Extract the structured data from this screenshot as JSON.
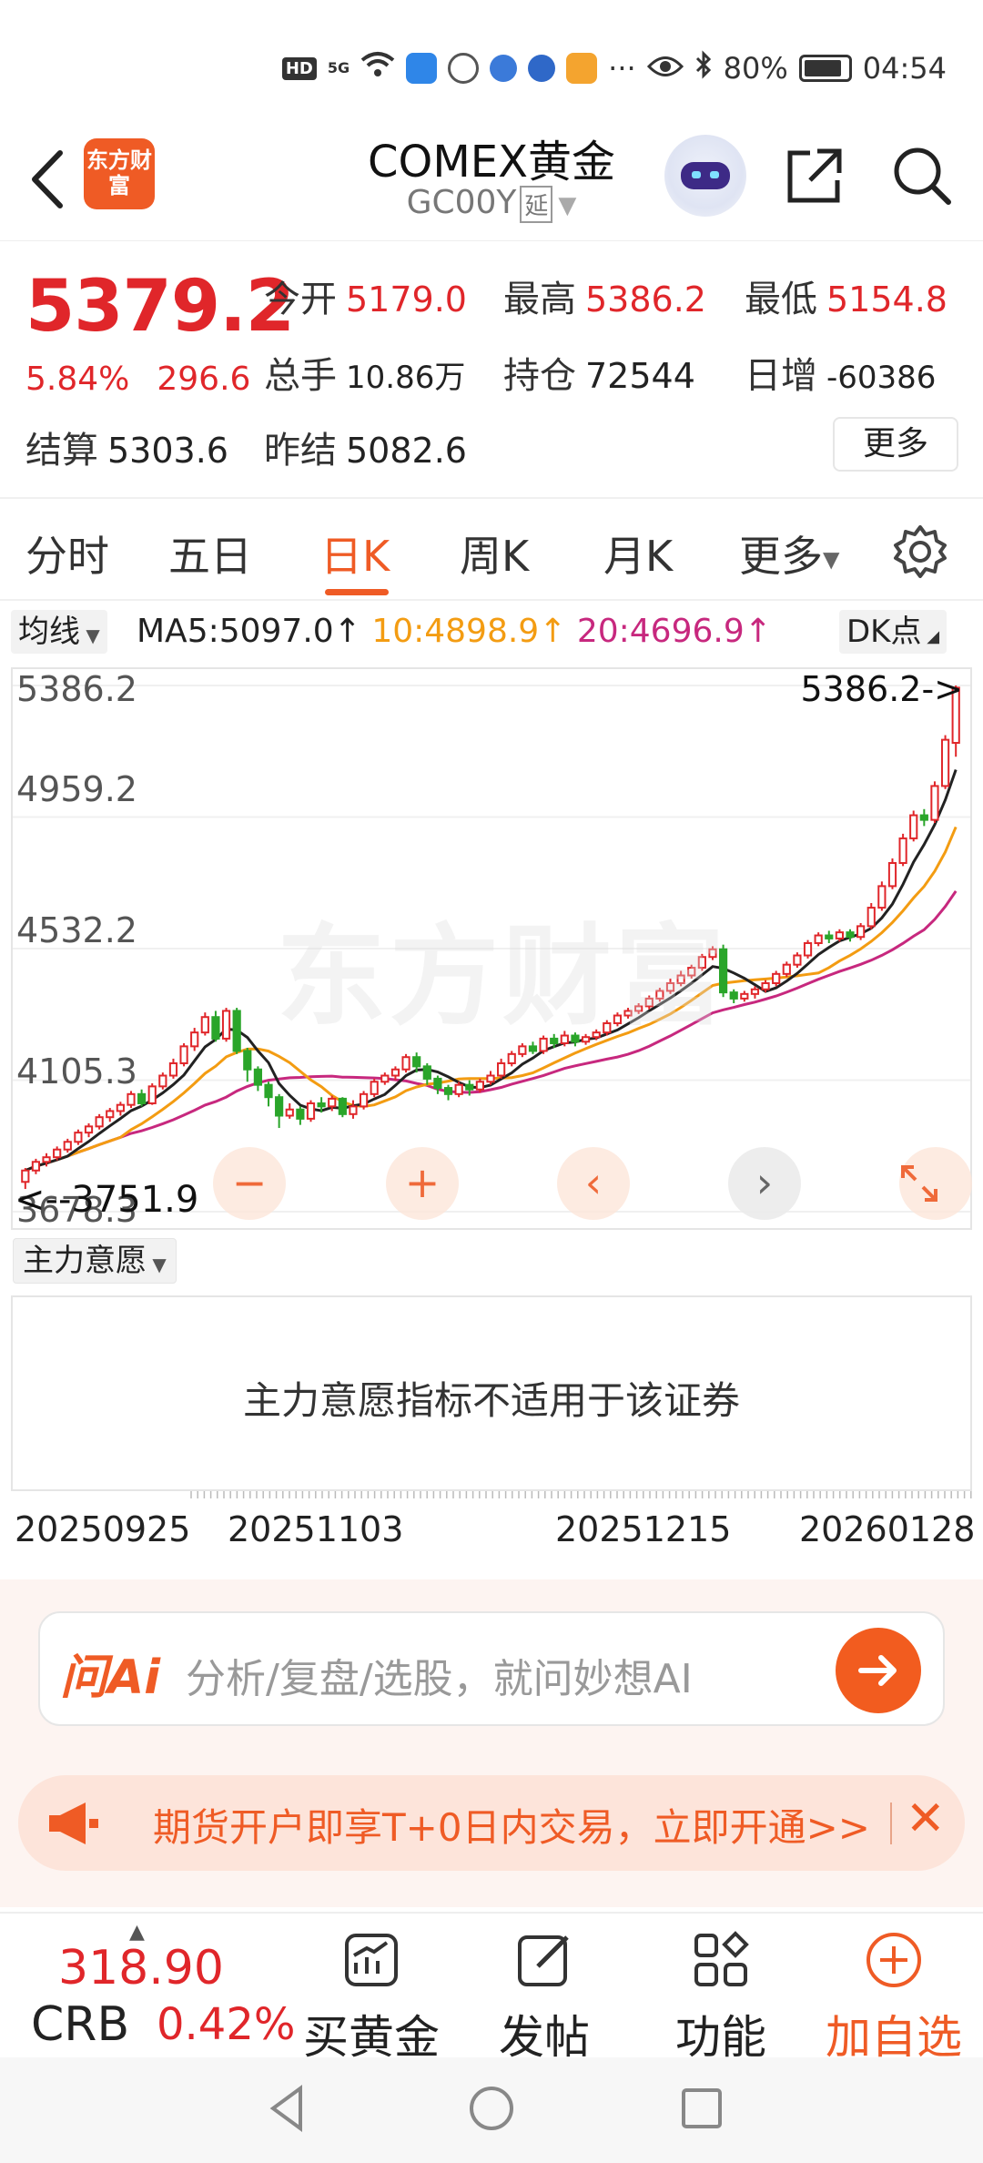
{
  "status": {
    "battery": "80%",
    "time": "04:54",
    "hd": "HD",
    "signal": "5G",
    "more": "···"
  },
  "header": {
    "logo": "东方财富",
    "title": "COMEX黄金",
    "code": "GC00Y",
    "delay_badge": "延"
  },
  "quote": {
    "price": "5379.2",
    "change_pct": "5.84%",
    "change": "296.6",
    "open_label": "今开",
    "open": "5179.0",
    "high_label": "最高",
    "high": "5386.2",
    "low_label": "最低",
    "low": "5154.8",
    "volume_label": "总手",
    "volume": "10.86万",
    "oi_label": "持仓",
    "oi": "72544",
    "daily_inc_label": "日增",
    "daily_inc": "-60386",
    "settle_label": "结算",
    "settle": "5303.6",
    "prev_settle_label": "昨结",
    "prev_settle": "5082.6",
    "more_button": "更多"
  },
  "tabs": [
    "分时",
    "五日",
    "日K",
    "周K",
    "月K",
    "更多"
  ],
  "active_tab": "日K",
  "ma": {
    "selector": "均线",
    "ma5": "MA5:5097.0↑",
    "ma10": "10:4898.9↑",
    "ma20": "20:4696.9↑",
    "dk": "DK点"
  },
  "chart_data": {
    "type": "candlestick",
    "y_ticks": [
      "5386.2",
      "4959.2",
      "4532.2",
      "4105.3",
      "3678.3"
    ],
    "high_marker": "5386.2->",
    "low_marker": "<--3751.9",
    "watermark": "东方财富",
    "ylim": [
      3678.3,
      5386.2
    ],
    "candles": [
      [
        3775,
        3812,
        3752,
        3820
      ],
      [
        3812,
        3840,
        3800,
        3850
      ],
      [
        3840,
        3855,
        3825,
        3868
      ],
      [
        3855,
        3880,
        3845,
        3890
      ],
      [
        3880,
        3905,
        3870,
        3915
      ],
      [
        3905,
        3935,
        3895,
        3945
      ],
      [
        3935,
        3955,
        3920,
        3965
      ],
      [
        3955,
        3985,
        3945,
        3995
      ],
      [
        3985,
        4005,
        3970,
        4015
      ],
      [
        4005,
        4025,
        3990,
        4035
      ],
      [
        4025,
        4060,
        4015,
        4070
      ],
      [
        4060,
        4030,
        4020,
        4075
      ],
      [
        4030,
        4085,
        4025,
        4095
      ],
      [
        4085,
        4120,
        4075,
        4130
      ],
      [
        4120,
        4160,
        4110,
        4175
      ],
      [
        4160,
        4215,
        4150,
        4225
      ],
      [
        4215,
        4260,
        4200,
        4275
      ],
      [
        4260,
        4310,
        4250,
        4325
      ],
      [
        4310,
        4240,
        4230,
        4330
      ],
      [
        4240,
        4330,
        4230,
        4340
      ],
      [
        4330,
        4200,
        4190,
        4340
      ],
      [
        4200,
        4140,
        4100,
        4210
      ],
      [
        4140,
        4090,
        4070,
        4150
      ],
      [
        4090,
        4050,
        4020,
        4100
      ],
      [
        4050,
        3990,
        3950,
        4060
      ],
      [
        3990,
        4010,
        3980,
        4030
      ],
      [
        4010,
        3980,
        3960,
        4020
      ],
      [
        3980,
        4030,
        3970,
        4040
      ],
      [
        4030,
        4020,
        4000,
        4050
      ],
      [
        4020,
        4045,
        4005,
        4055
      ],
      [
        4045,
        3995,
        3985,
        4050
      ],
      [
        3995,
        4020,
        3980,
        4040
      ],
      [
        4020,
        4060,
        4010,
        4070
      ],
      [
        4060,
        4100,
        4050,
        4110
      ],
      [
        4100,
        4120,
        4090,
        4130
      ],
      [
        4120,
        4140,
        4105,
        4150
      ],
      [
        4140,
        4180,
        4130,
        4190
      ],
      [
        4180,
        4150,
        4130,
        4195
      ],
      [
        4150,
        4110,
        4090,
        4160
      ],
      [
        4110,
        4080,
        4060,
        4120
      ],
      [
        4080,
        4060,
        4040,
        4090
      ],
      [
        4060,
        4090,
        4050,
        4100
      ],
      [
        4090,
        4075,
        4055,
        4105
      ],
      [
        4075,
        4100,
        4065,
        4110
      ],
      [
        4100,
        4120,
        4090,
        4135
      ],
      [
        4120,
        4160,
        4110,
        4175
      ],
      [
        4160,
        4190,
        4150,
        4200
      ],
      [
        4190,
        4215,
        4180,
        4225
      ],
      [
        4215,
        4200,
        4190,
        4230
      ],
      [
        4200,
        4240,
        4190,
        4250
      ],
      [
        4240,
        4225,
        4210,
        4255
      ],
      [
        4225,
        4250,
        4215,
        4265
      ],
      [
        4250,
        4230,
        4215,
        4260
      ],
      [
        4230,
        4245,
        4220,
        4255
      ],
      [
        4245,
        4260,
        4235,
        4270
      ],
      [
        4260,
        4290,
        4250,
        4300
      ],
      [
        4290,
        4315,
        4280,
        4325
      ],
      [
        4315,
        4330,
        4305,
        4340
      ],
      [
        4330,
        4345,
        4320,
        4355
      ],
      [
        4345,
        4370,
        4335,
        4380
      ],
      [
        4370,
        4395,
        4360,
        4405
      ],
      [
        4395,
        4420,
        4385,
        4435
      ],
      [
        4420,
        4445,
        4410,
        4460
      ],
      [
        4445,
        4470,
        4435,
        4480
      ],
      [
        4470,
        4505,
        4460,
        4515
      ],
      [
        4505,
        4530,
        4495,
        4540
      ],
      [
        4530,
        4390,
        4375,
        4545
      ],
      [
        4390,
        4370,
        4355,
        4400
      ],
      [
        4370,
        4385,
        4360,
        4395
      ],
      [
        4385,
        4400,
        4370,
        4410
      ],
      [
        4400,
        4420,
        4390,
        4430
      ],
      [
        4420,
        4450,
        4410,
        4460
      ],
      [
        4450,
        4480,
        4440,
        4490
      ],
      [
        4480,
        4510,
        4470,
        4520
      ],
      [
        4510,
        4550,
        4500,
        4560
      ],
      [
        4550,
        4575,
        4540,
        4585
      ],
      [
        4575,
        4565,
        4550,
        4590
      ],
      [
        4565,
        4585,
        4555,
        4595
      ],
      [
        4585,
        4570,
        4555,
        4595
      ],
      [
        4570,
        4605,
        4560,
        4615
      ],
      [
        4605,
        4665,
        4595,
        4680
      ],
      [
        4665,
        4735,
        4655,
        4750
      ],
      [
        4735,
        4810,
        4725,
        4825
      ],
      [
        4810,
        4890,
        4800,
        4905
      ],
      [
        4890,
        4965,
        4880,
        4980
      ],
      [
        4965,
        4950,
        4930,
        4985
      ],
      [
        4950,
        5060,
        4940,
        5075
      ],
      [
        5060,
        5210,
        5050,
        5225
      ],
      [
        5200,
        5379.2,
        5154.8,
        5386.2
      ]
    ]
  },
  "indicator": {
    "selector": "主力意愿",
    "message": "主力意愿指标不适用于该证券"
  },
  "x_dates": [
    "20250925",
    "20251103",
    "20251215",
    "20260128"
  ],
  "ai": {
    "logo": "问Ai",
    "placeholder": "分析/复盘/选股，就问妙想AI"
  },
  "promo": {
    "text": "期货开户即享T+0日内交易，立即开通>>"
  },
  "bottom": {
    "crb_value": "318.90",
    "crb_label": "CRB",
    "crb_pct": "0.42%",
    "buy_gold": "买黄金",
    "post": "发帖",
    "functions": "功能",
    "add_watch": "加自选"
  },
  "colors": {
    "up": "#e0262a",
    "down": "#2aa52a",
    "ma5": "#222222",
    "ma10": "#f39c12",
    "ma20": "#c7287e",
    "accent": "#ef5b25"
  }
}
